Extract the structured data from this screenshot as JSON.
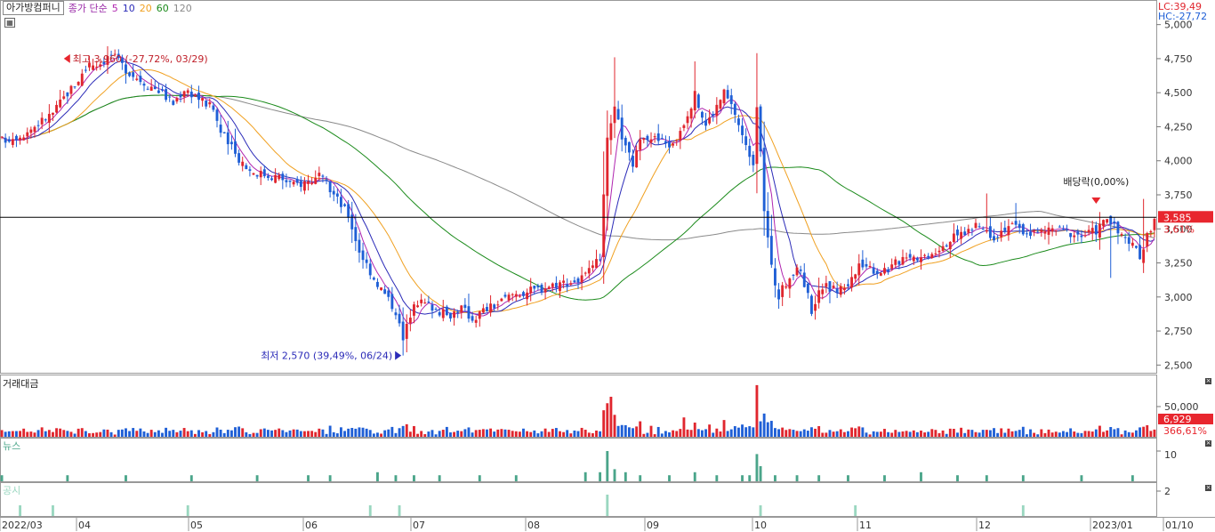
{
  "legend": {
    "stock_name": "아가방컴퍼니",
    "ma_label": "종가 단순",
    "periods": [
      {
        "label": "5",
        "color": "#b026b0"
      },
      {
        "label": "10",
        "color": "#2b2bb8"
      },
      {
        "label": "20",
        "color": "#f0a020"
      },
      {
        "label": "60",
        "color": "#1a8a1a"
      },
      {
        "label": "120",
        "color": "#8a8a8a"
      }
    ]
  },
  "right_info": {
    "lc": "LC:39,49",
    "hc": "HC:-27,72"
  },
  "price_axis": {
    "ticks": [
      "5,000",
      "4,750",
      "4,500",
      "4,250",
      "4,000",
      "3,750",
      "3,500",
      "3,250",
      "3,000",
      "2,750",
      "2,500"
    ],
    "values": [
      5000,
      4750,
      4500,
      4250,
      4000,
      3750,
      3500,
      3250,
      3000,
      2750,
      2500
    ],
    "ylim": [
      2450,
      5050
    ]
  },
  "current": {
    "price_label": "3,585",
    "price": 3585,
    "change_label": "3,61%"
  },
  "annotations": {
    "high": "최고 3,960 (-27,72%, 03/29)",
    "low": "최저 2,570 (39,49%, 06/24)",
    "dividend": "배당락(0,00%)"
  },
  "volume_panel": {
    "title": "거래대금",
    "tick": "50,000",
    "current_label": "6,929",
    "change_label": "366,61%"
  },
  "news_panel": {
    "title": "뉴스",
    "tick": "10"
  },
  "disclosure_panel": {
    "title": "공시",
    "tick": "2"
  },
  "x_axis": {
    "labels": [
      "2022/03",
      "04",
      "05",
      "06",
      "07",
      "08",
      "09",
      "10",
      "11",
      "12",
      "2023/01",
      "01/10"
    ]
  },
  "colors": {
    "up": "#e0262e",
    "down": "#1f5fd6",
    "news": "#4aa58a",
    "disclosure": "#9ad7c0",
    "price_line": "#000000",
    "highlight": "#e8262e"
  },
  "chart_data": {
    "type": "candlestick",
    "series": [
      {
        "name": "5",
        "values": "MA5"
      },
      {
        "name": "10",
        "values": "MA10"
      },
      {
        "name": "20",
        "values": "MA20"
      },
      {
        "name": "60",
        "values": "MA60"
      },
      {
        "name": "120",
        "values": "MA120"
      }
    ],
    "anchors": [
      [
        0,
        4150
      ],
      [
        6,
        4200
      ],
      [
        14,
        4350
      ],
      [
        18,
        4500
      ],
      [
        20,
        4560
      ],
      [
        24,
        4710
      ],
      [
        27,
        4720
      ],
      [
        30,
        4780
      ],
      [
        35,
        4650
      ],
      [
        40,
        4560
      ],
      [
        43,
        4520
      ],
      [
        47,
        4420
      ],
      [
        50,
        4530
      ],
      [
        53,
        4480
      ],
      [
        58,
        4380
      ],
      [
        60,
        4210
      ],
      [
        64,
        4050
      ],
      [
        68,
        3930
      ],
      [
        72,
        3900
      ],
      [
        76,
        3880
      ],
      [
        80,
        3820
      ],
      [
        84,
        3850
      ],
      [
        87,
        3880
      ],
      [
        90,
        3790
      ],
      [
        95,
        3600
      ],
      [
        98,
        3340
      ],
      [
        102,
        3140
      ],
      [
        105,
        3020
      ],
      [
        108,
        2900
      ],
      [
        110,
        2680
      ],
      [
        113,
        2980
      ],
      [
        118,
        2930
      ],
      [
        122,
        2860
      ],
      [
        126,
        2920
      ],
      [
        129,
        2840
      ],
      [
        132,
        2900
      ],
      [
        136,
        2950
      ],
      [
        140,
        3020
      ],
      [
        146,
        3050
      ],
      [
        152,
        3100
      ],
      [
        158,
        3120
      ],
      [
        162,
        3200
      ],
      [
        164,
        3300
      ],
      [
        166,
        4140
      ],
      [
        168,
        4370
      ],
      [
        171,
        4090
      ],
      [
        173,
        3980
      ],
      [
        176,
        4200
      ],
      [
        180,
        4150
      ],
      [
        184,
        4110
      ],
      [
        187,
        4290
      ],
      [
        190,
        4480
      ],
      [
        193,
        4260
      ],
      [
        196,
        4400
      ],
      [
        198,
        4500
      ],
      [
        201,
        4350
      ],
      [
        204,
        4100
      ],
      [
        206,
        4000
      ],
      [
        207,
        4420
      ],
      [
        209,
        3650
      ],
      [
        211,
        3210
      ],
      [
        213,
        3000
      ],
      [
        216,
        3160
      ],
      [
        219,
        3200
      ],
      [
        222,
        2910
      ],
      [
        225,
        3080
      ],
      [
        229,
        3050
      ],
      [
        232,
        3100
      ],
      [
        236,
        3250
      ],
      [
        240,
        3190
      ],
      [
        244,
        3220
      ],
      [
        248,
        3320
      ],
      [
        252,
        3290
      ],
      [
        256,
        3350
      ],
      [
        260,
        3420
      ],
      [
        264,
        3480
      ],
      [
        268,
        3520
      ],
      [
        272,
        3450
      ],
      [
        276,
        3530
      ],
      [
        280,
        3480
      ],
      [
        284,
        3470
      ],
      [
        288,
        3500
      ],
      [
        292,
        3480
      ],
      [
        296,
        3450
      ],
      [
        300,
        3490
      ],
      [
        303,
        3580
      ],
      [
        306,
        3470
      ],
      [
        309,
        3400
      ],
      [
        312,
        3300
      ],
      [
        314,
        3450
      ],
      [
        316,
        3585
      ]
    ],
    "ma_settings": [
      5,
      10,
      20,
      60,
      120
    ],
    "x_months": [
      "2022/03",
      "04",
      "05",
      "06",
      "07",
      "08",
      "09",
      "10",
      "11",
      "12",
      "2023/01",
      "01/10"
    ],
    "ylim": [
      2450,
      5050
    ],
    "high": {
      "value": 3960,
      "date": "03/29"
    },
    "low": {
      "value": 2570,
      "date": "06/24"
    }
  }
}
